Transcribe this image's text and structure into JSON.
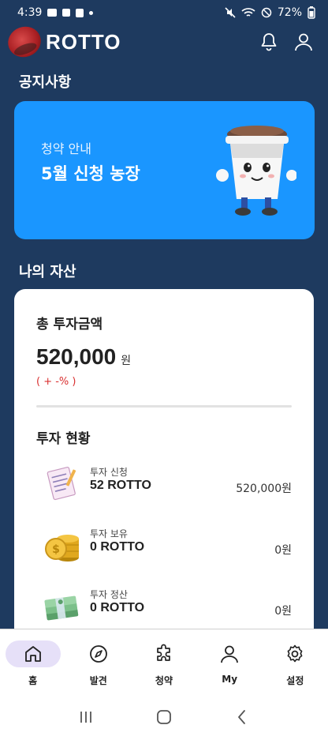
{
  "status_bar": {
    "time": "4:39",
    "battery": "72%"
  },
  "app": {
    "logo_text": "ROTTO"
  },
  "notice": {
    "section_title": "공지사항",
    "subtitle": "청약 안내",
    "title": "5월 신청 농장"
  },
  "assets": {
    "section_title": "나의 자산",
    "total_label": "총 투자금액",
    "total_amount": "520,000",
    "total_unit": "원",
    "total_change": "( + -% )",
    "status_label": "투자 현황",
    "items": [
      {
        "label": "투자 신청",
        "amount": "52 ROTTO",
        "value": "520,000원",
        "icon": "application-form-icon"
      },
      {
        "label": "투자 보유",
        "amount": "0 ROTTO",
        "value": "0원",
        "icon": "gold-coins-icon"
      },
      {
        "label": "투자 정산",
        "amount": "0 ROTTO",
        "value": "0원",
        "icon": "cash-stack-icon"
      }
    ]
  },
  "nav": [
    {
      "label": "홈",
      "icon": "home-icon",
      "active": true
    },
    {
      "label": "발견",
      "icon": "compass-icon",
      "active": false
    },
    {
      "label": "청약",
      "icon": "puzzle-icon",
      "active": false
    },
    {
      "label": "My",
      "icon": "user-icon",
      "active": false
    },
    {
      "label": "설정",
      "icon": "gear-icon",
      "active": false
    }
  ],
  "colors": {
    "background": "#1e3a5f",
    "notice_card": "#1a96ff",
    "active_nav_pill": "#e6e0f8",
    "change_text": "#d93030"
  }
}
